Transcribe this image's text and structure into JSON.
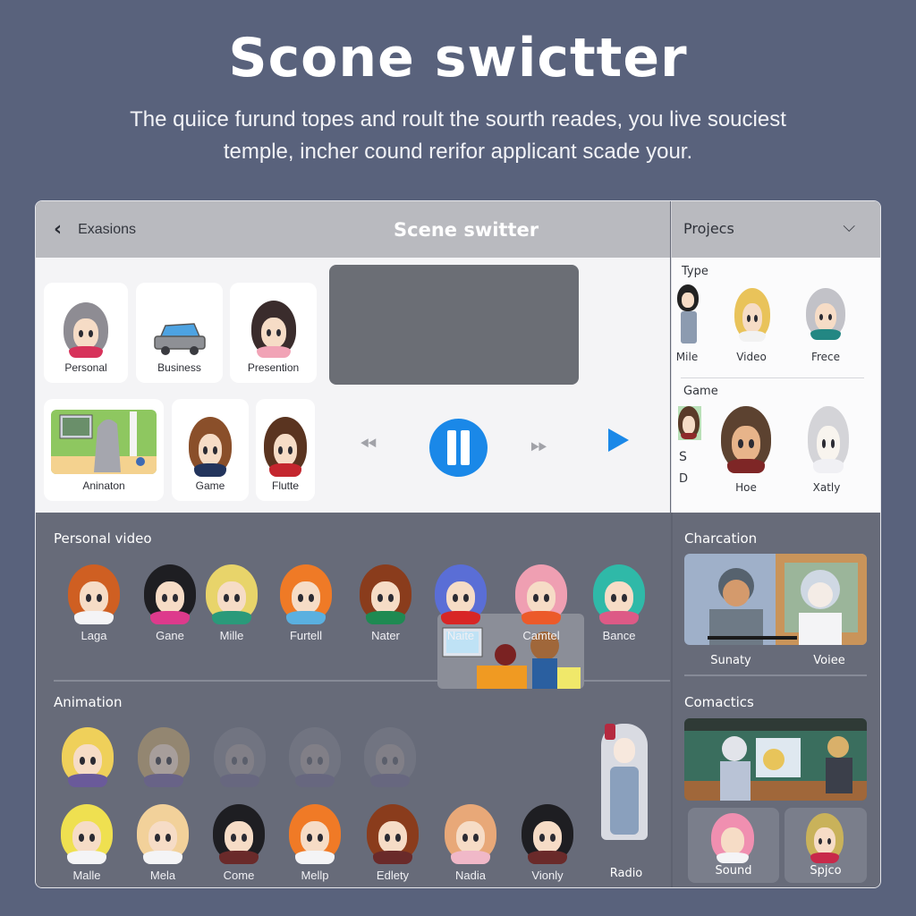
{
  "hero": {
    "title": "Scone swictter",
    "subtitle_line1": "The quiice furund topes and roult the sourth reades, you live souciest",
    "subtitle_line2": "temple, incher cound rerifor applicant scade your."
  },
  "window": {
    "back_label": "Exasions",
    "title": "Scene switter",
    "projects_dropdown": {
      "label": "Projecs",
      "icon": "chevron-down-icon"
    }
  },
  "templates": [
    {
      "label": "Personal",
      "icon": "avatar-girl"
    },
    {
      "label": "Business",
      "icon": "car"
    },
    {
      "label": "Presention",
      "icon": "avatar-girl"
    },
    {
      "label": "Aninaton",
      "icon": "scene-room"
    },
    {
      "label": "Game",
      "icon": "avatar-boy"
    },
    {
      "label": "Flutte",
      "icon": "avatar-boy"
    }
  ],
  "player": {
    "controls": [
      "rewind-icon",
      "pause-icon",
      "fast-forward-icon",
      "play-icon"
    ],
    "accent_color": "#1a88e8"
  },
  "projects_panel": {
    "type_section": {
      "title": "Type",
      "items": [
        "Mile",
        "Video",
        "Frece"
      ]
    },
    "game_section": {
      "title": "Game",
      "side_letters": [
        "S",
        "D"
      ],
      "items": [
        "Hoe",
        "Xatly"
      ]
    }
  },
  "personal_video": {
    "title": "Personal video",
    "characters": [
      "Laga",
      "Gane",
      "Mille",
      "Furtell",
      "Nater",
      "Naite",
      "Camtel",
      "Bance"
    ]
  },
  "animation": {
    "title": "Animation",
    "top_row_count": 5,
    "characters": [
      "Malle",
      "Mela",
      "Come",
      "Mellp",
      "Edlety",
      "Nadia",
      "Vionly",
      "Radio"
    ]
  },
  "charcation": {
    "title": "Charcation",
    "labels": [
      "Sunaty",
      "Voiee"
    ]
  },
  "comactics": {
    "title": "Comactics",
    "cards": [
      "Sound",
      "Spjco"
    ]
  }
}
